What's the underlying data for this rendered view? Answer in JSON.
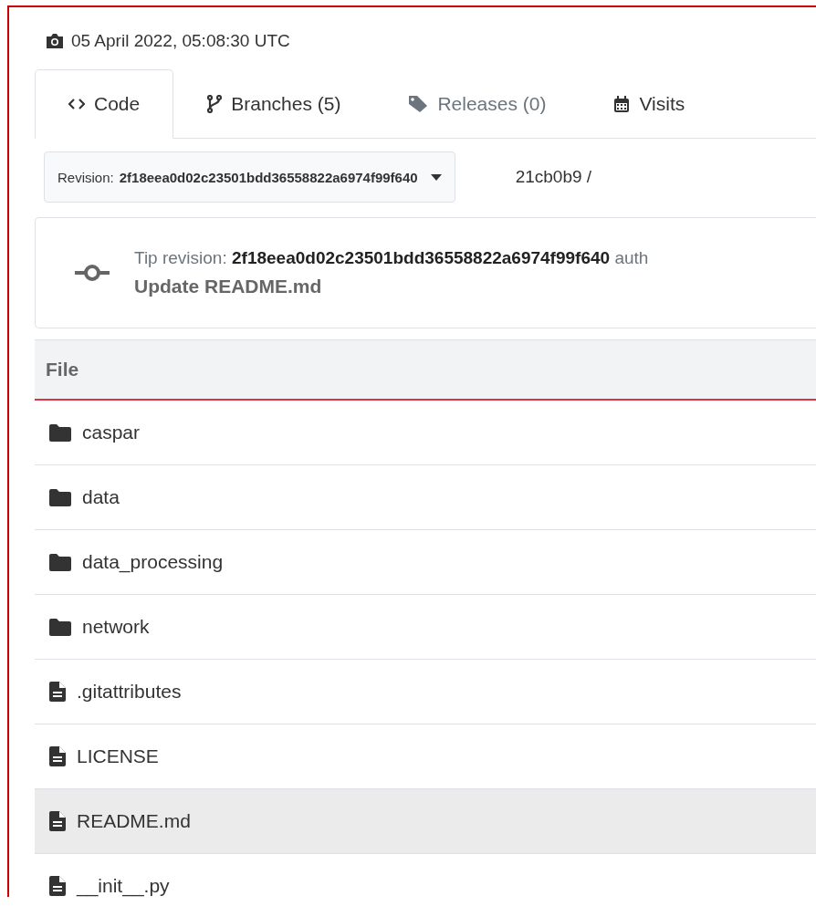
{
  "snapshot": {
    "date": "05 April 2022, 05:08:30 UTC"
  },
  "tabs": [
    {
      "label": "Code",
      "kind": "code",
      "selected": true,
      "disabled": false
    },
    {
      "label": "Branches (5)",
      "kind": "branch",
      "selected": false,
      "disabled": false
    },
    {
      "label": "Releases (0)",
      "kind": "tag",
      "selected": false,
      "disabled": true
    },
    {
      "label": "Visits",
      "kind": "calendar",
      "selected": false,
      "disabled": false
    }
  ],
  "revision": {
    "label": "Revision:",
    "value": "2f18eea0d02c23501bdd36558822a6974f99f640"
  },
  "breadcrumb": "21cb0b9 /",
  "tip": {
    "label": "Tip revision:",
    "hash": "2f18eea0d02c23501bdd36558822a6974f99f640",
    "rest": "auth",
    "message": "Update README.md"
  },
  "table": {
    "columns": [
      "File"
    ],
    "rows": [
      {
        "name": "caspar",
        "kind": "folder",
        "selected": false
      },
      {
        "name": "data",
        "kind": "folder",
        "selected": false
      },
      {
        "name": "data_processing",
        "kind": "folder",
        "selected": false
      },
      {
        "name": "network",
        "kind": "folder",
        "selected": false
      },
      {
        "name": ".gitattributes",
        "kind": "file",
        "selected": false
      },
      {
        "name": "LICENSE",
        "kind": "file",
        "selected": false
      },
      {
        "name": "README.md",
        "kind": "file",
        "selected": true
      },
      {
        "name": "__init__.py",
        "kind": "file",
        "selected": false
      }
    ]
  }
}
